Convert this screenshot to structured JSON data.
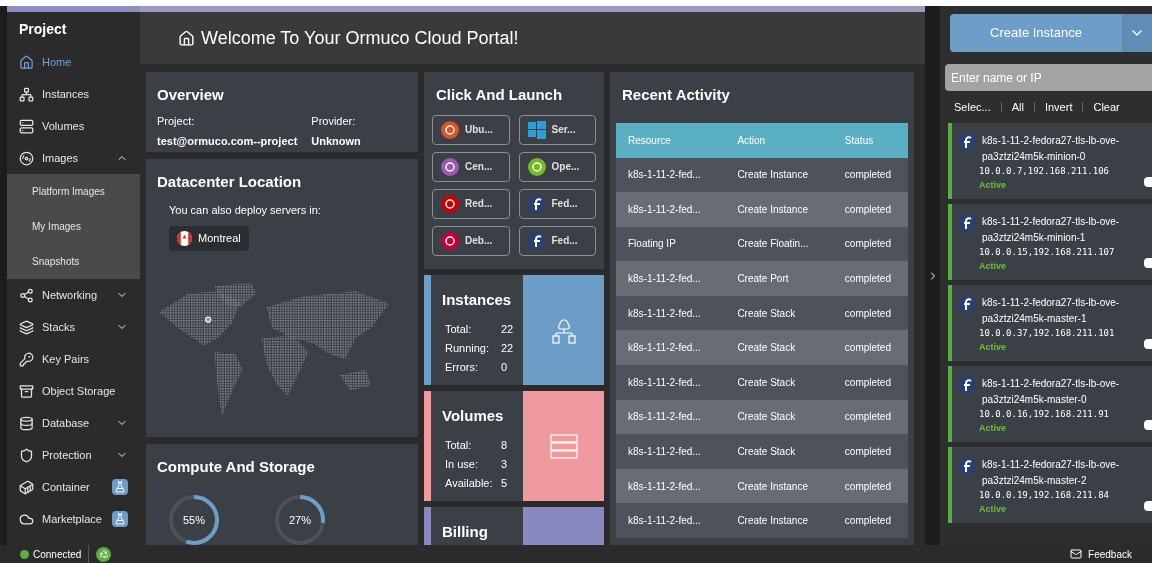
{
  "sidebar": {
    "title": "Project",
    "items": [
      {
        "label": "Home",
        "selected": true
      },
      {
        "label": "Instances",
        "selected": false
      },
      {
        "label": "Volumes",
        "selected": false
      },
      {
        "label": "Images",
        "selected": false,
        "expanded": true,
        "children": [
          {
            "label": "Platform Images"
          },
          {
            "label": "My Images"
          },
          {
            "label": "Snapshots"
          }
        ]
      },
      {
        "label": "Networking",
        "selected": false,
        "expanded": false
      },
      {
        "label": "Stacks",
        "selected": false,
        "expanded": false
      },
      {
        "label": "Key Pairs",
        "selected": false
      },
      {
        "label": "Object Storage",
        "selected": false
      },
      {
        "label": "Database",
        "selected": false,
        "expanded": false
      },
      {
        "label": "Protection",
        "selected": false,
        "expanded": false
      },
      {
        "label": "Container",
        "selected": false,
        "beta": true
      },
      {
        "label": "Marketplace",
        "selected": false,
        "beta": true
      }
    ]
  },
  "header": {
    "title": "Welcome To Your Ormuco Cloud Portal!"
  },
  "overview": {
    "title": "Overview",
    "fields": [
      {
        "label": "Project:",
        "value": "test@ormuco.com--project"
      },
      {
        "label": "Provider:",
        "value": "Unknown"
      }
    ]
  },
  "datacenter": {
    "title": "Datacenter Location",
    "subtitle": "You can also deploy servers in:",
    "locations": [
      "Montreal"
    ]
  },
  "compute": {
    "title": "Compute And Storage",
    "gauges": [
      {
        "reading": "55%",
        "level": 0.55
      },
      {
        "reading": "27%",
        "level": 0.27
      }
    ]
  },
  "launch": {
    "title": "Click And Launch",
    "images": [
      {
        "label": "Ubu...",
        "kind": "ubuntu"
      },
      {
        "label": "Ser...",
        "kind": "windows"
      },
      {
        "label": "Cen...",
        "kind": "centos"
      },
      {
        "label": "Ope...",
        "kind": "opensuse"
      },
      {
        "label": "Red...",
        "kind": "redhat"
      },
      {
        "label": "Fed...",
        "kind": "fedora"
      },
      {
        "label": "Deb...",
        "kind": "debian"
      },
      {
        "label": "Fed...",
        "kind": "fedora"
      }
    ]
  },
  "stats": [
    {
      "title": "Instances",
      "kind": "instances",
      "color": "#6d9ec8",
      "rows": [
        {
          "label": "Total:",
          "value": "22"
        },
        {
          "label": "Running:",
          "value": "22"
        },
        {
          "label": "Errors:",
          "value": "0"
        }
      ]
    },
    {
      "title": "Volumes",
      "kind": "volumes",
      "color": "#ef9a9f",
      "rows": [
        {
          "label": "Total:",
          "value": "8"
        },
        {
          "label": "In use:",
          "value": "3"
        },
        {
          "label": "Available:",
          "value": "5"
        }
      ]
    },
    {
      "title": "Billing",
      "kind": "billing",
      "color": "#8a88c0"
    }
  ],
  "activity": {
    "title": "Recent Activity",
    "columns": [
      "Resource",
      "Action",
      "Status"
    ],
    "rows": [
      [
        "k8s-1-11-2-fed...",
        "Create Instance",
        "completed"
      ],
      [
        "k8s-1-11-2-fed...",
        "Create Instance",
        "completed"
      ],
      [
        "Floating IP",
        "Create Floatin...",
        "completed"
      ],
      [
        "k8s-1-11-2-fed...",
        "Create Port",
        "completed"
      ],
      [
        "k8s-1-11-2-fed...",
        "Create Stack",
        "completed"
      ],
      [
        "k8s-1-11-2-fed...",
        "Create Stack",
        "completed"
      ],
      [
        "k8s-1-11-2-fed...",
        "Create Stack",
        "completed"
      ],
      [
        "k8s-1-11-2-fed...",
        "Create Stack",
        "completed"
      ],
      [
        "k8s-1-11-2-fed...",
        "Create Stack",
        "completed"
      ],
      [
        "k8s-1-11-2-fed...",
        "Create Instance",
        "completed"
      ],
      [
        "k8s-1-11-2-fed...",
        "Create Instance",
        "completed"
      ]
    ]
  },
  "panel": {
    "create_button": "Create Instance",
    "search": {
      "placeholder": "Enter name or IP"
    },
    "select_actions": [
      "Selec...",
      "All",
      "Invert",
      "Clear"
    ],
    "instances": [
      {
        "name": "k8s-1-11-2-fedora27-tls-lb-ove-pa3ztzi24m5k-minion-0",
        "ips": "10.0.0.7,192.168.211.106",
        "status": "Active",
        "checked": false
      },
      {
        "name": "k8s-1-11-2-fedora27-tls-lb-ove-pa3ztzi24m5k-minion-1",
        "ips": "10.0.0.15,192.168.211.107",
        "status": "Active",
        "checked": false
      },
      {
        "name": "k8s-1-11-2-fedora27-tls-lb-ove-pa3ztzi24m5k-master-1",
        "ips": "10.0.0.37,192.168.211.101",
        "status": "Active",
        "checked": false
      },
      {
        "name": "k8s-1-11-2-fedora27-tls-lb-ove-pa3ztzi24m5k-master-0",
        "ips": "10.0.0.16,192.168.211.91",
        "status": "Active",
        "checked": false
      },
      {
        "name": "k8s-1-11-2-fedora27-tls-lb-ove-pa3ztzi24m5k-master-2",
        "ips": "10.0.0.19,192.168.211.84",
        "status": "Active",
        "checked": false
      }
    ]
  },
  "status_bar": {
    "connection": "Connected",
    "feedback": "Feedback"
  }
}
